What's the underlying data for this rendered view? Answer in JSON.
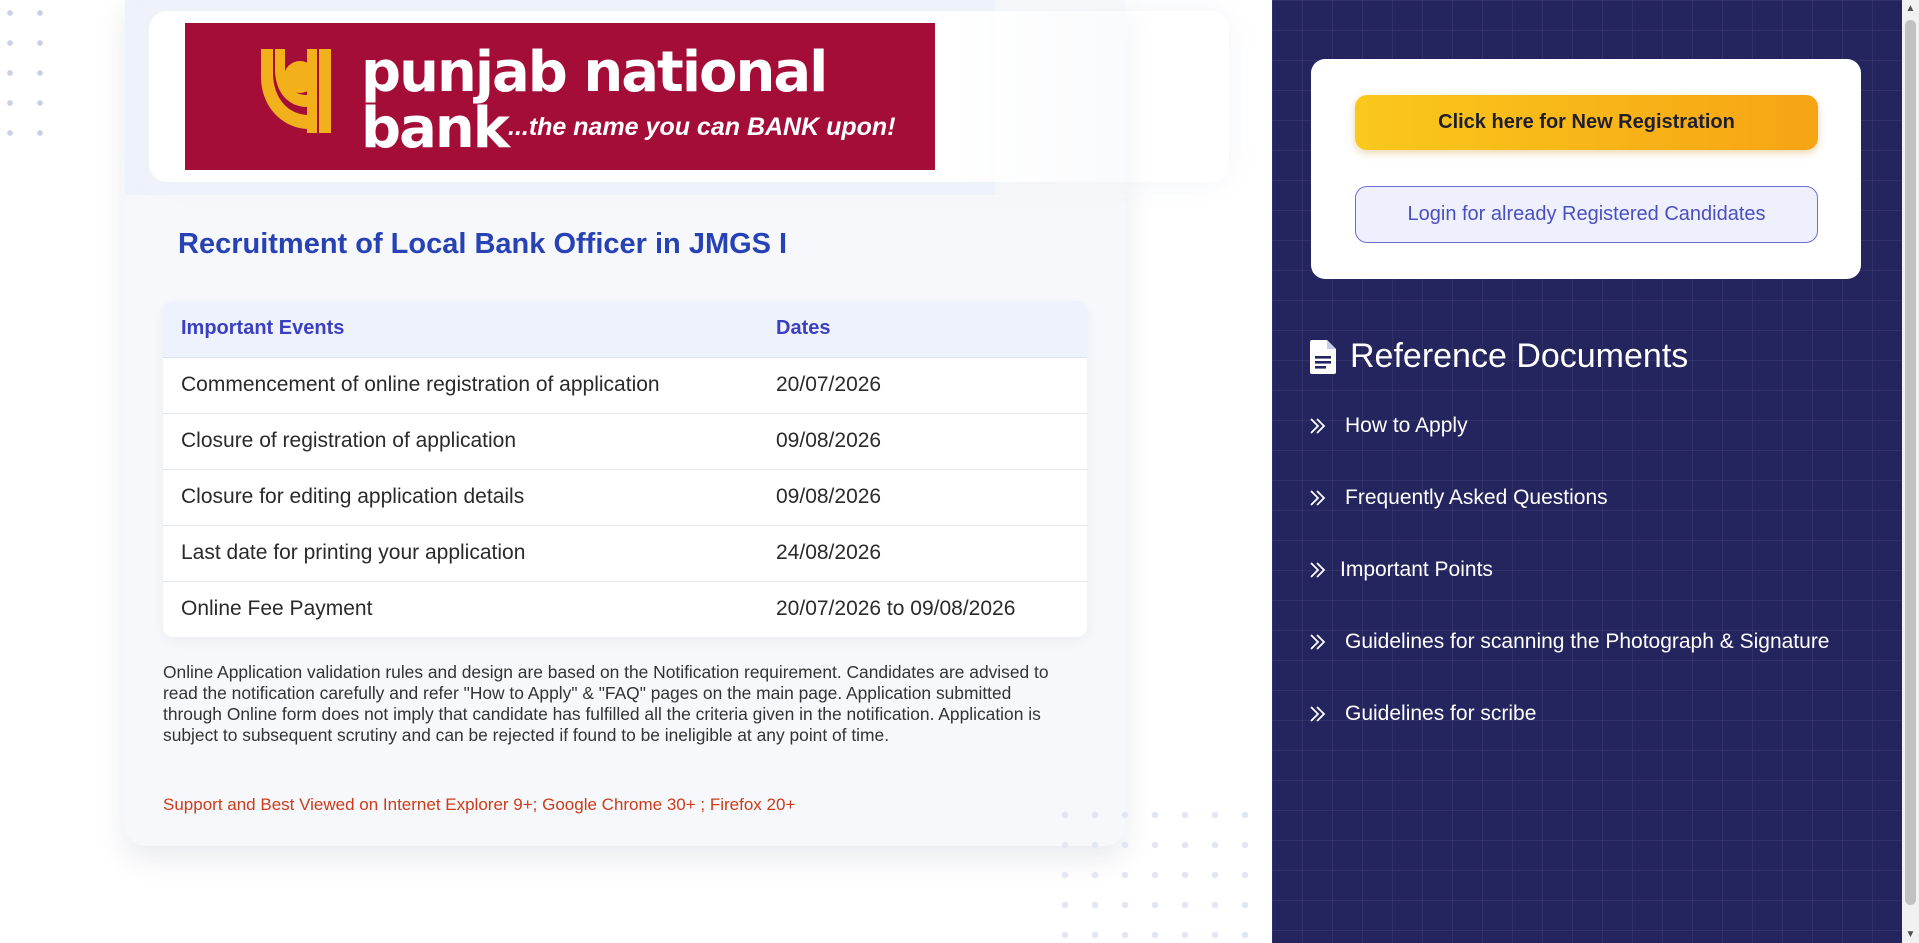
{
  "bank": {
    "name": "punjab national bank",
    "tagline": "...the name you can BANK upon!",
    "brand_color": "#a30d38",
    "logo_color": "#f2b11b"
  },
  "page": {
    "title": "Recruitment of Local Bank Officer in JMGS I"
  },
  "events_table": {
    "headers": {
      "event": "Important Events",
      "date": "Dates"
    },
    "rows": [
      {
        "event": "Commencement of online registration of application",
        "date": "20/07/2026"
      },
      {
        "event": "Closure of registration of application",
        "date": "09/08/2026"
      },
      {
        "event": "Closure for editing application details",
        "date": "09/08/2026"
      },
      {
        "event": "Last date for printing your application",
        "date": "24/08/2026"
      },
      {
        "event": "Online Fee Payment",
        "date": "20/07/2026 to 09/08/2026"
      }
    ]
  },
  "note": "Online Application validation rules and design are based on the Notification requirement. Candidates are advised to read the notification carefully and refer \"How to Apply\" & \"FAQ\" pages on the main page. Application submitted through Online form does not imply that candidate has fulfilled all the criteria given in the notification. Application is subject to subsequent scrutiny and can be rejected if found to be ineligible at any point of time.",
  "support_text": "Support and Best Viewed on Internet Explorer 9+; Google Chrome 30+ ; Firefox 20+",
  "actions": {
    "new_registration": "Click here for New Registration",
    "login": "Login for already Registered Candidates"
  },
  "reference": {
    "heading": "Reference Documents",
    "icon": "document-icon",
    "items": [
      "How to Apply",
      "Frequently Asked Questions",
      "Important Points",
      "Guidelines for scanning the Photograph & Signature",
      "Guidelines for scribe"
    ]
  },
  "colors": {
    "panel_bg": "#24245e",
    "title_blue": "#2742b4",
    "accent_yellow": "#fac81c",
    "support_red": "#cc3b1a"
  }
}
